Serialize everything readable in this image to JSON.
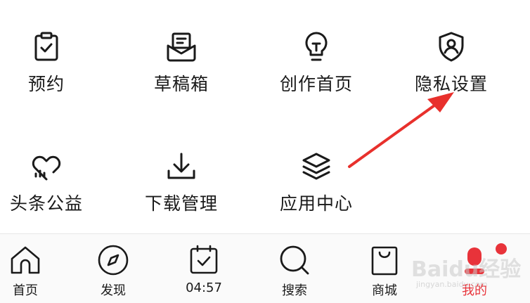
{
  "menu": {
    "items": [
      {
        "label": "预约",
        "icon": "clipboard-check-icon"
      },
      {
        "label": "草稿箱",
        "icon": "draft-box-icon"
      },
      {
        "label": "创作首页",
        "icon": "lightbulb-icon"
      },
      {
        "label": "隐私设置",
        "icon": "shield-user-icon"
      },
      {
        "label": "头条公益",
        "icon": "heart-chart-icon"
      },
      {
        "label": "下载管理",
        "icon": "download-icon"
      },
      {
        "label": "应用中心",
        "icon": "layers-icon"
      }
    ]
  },
  "tabbar": {
    "tabs": [
      {
        "label": "首页",
        "icon": "home-icon"
      },
      {
        "label": "发现",
        "icon": "compass-icon"
      },
      {
        "label": "04:57",
        "icon": "calendar-check-icon"
      },
      {
        "label": "搜索",
        "icon": "search-icon"
      },
      {
        "label": "商城",
        "icon": "shopping-bag-icon"
      },
      {
        "label": "我的",
        "icon": "user-icon"
      }
    ],
    "active_index": 5
  },
  "watermark": {
    "text": "Baidu经验",
    "sub": "jingyan.baidu.com"
  },
  "colors": {
    "accent": "#e8333a",
    "text": "#1a1a1a",
    "arrow": "#e8302c"
  }
}
